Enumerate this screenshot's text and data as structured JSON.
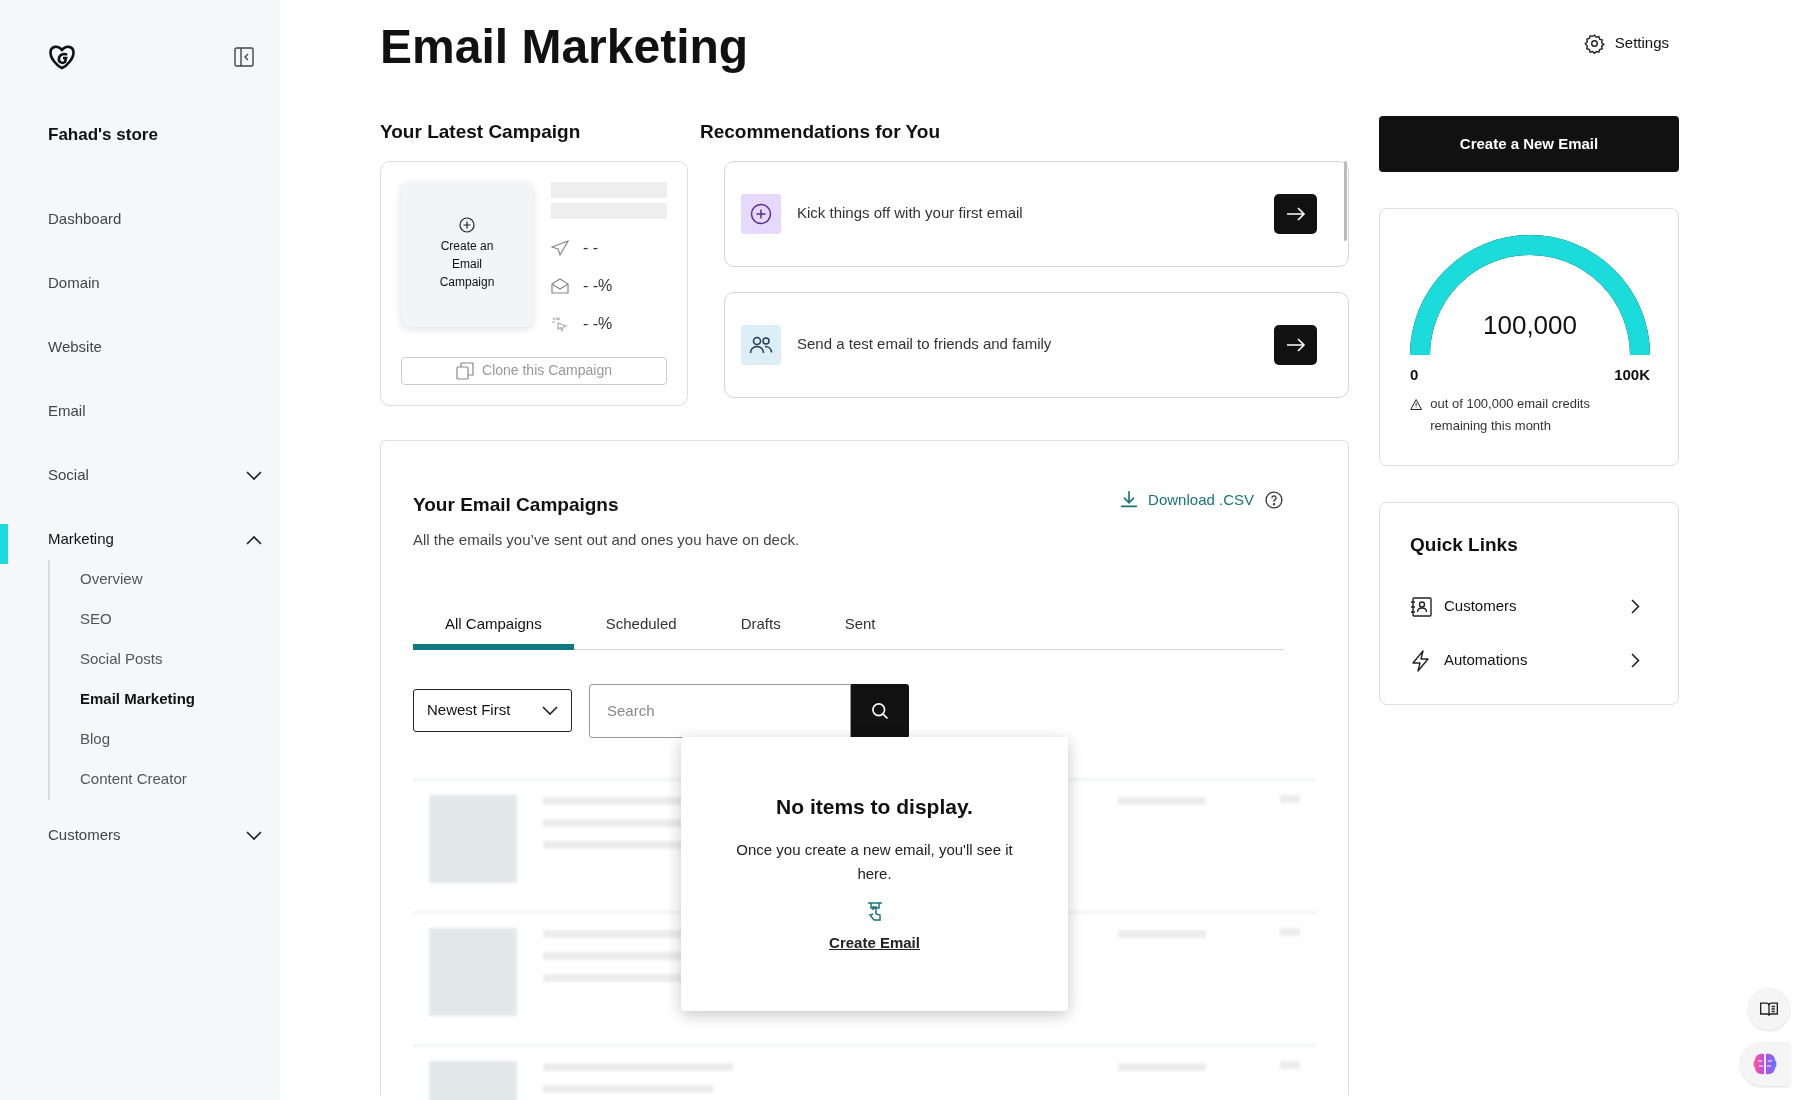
{
  "sidebar": {
    "store_name": "Fahad's store",
    "items": [
      {
        "label": "Dashboard",
        "kind": "link",
        "selected": false
      },
      {
        "label": "Domain",
        "kind": "link",
        "selected": false
      },
      {
        "label": "Website",
        "kind": "link",
        "selected": false
      },
      {
        "label": "Email",
        "kind": "link",
        "selected": false
      },
      {
        "label": "Social",
        "kind": "group",
        "selected": false,
        "expanded": false
      },
      {
        "label": "Marketing",
        "kind": "group",
        "selected": true,
        "expanded": true,
        "children": [
          {
            "label": "Overview",
            "selected": false
          },
          {
            "label": "SEO",
            "selected": false
          },
          {
            "label": "Social Posts",
            "selected": false
          },
          {
            "label": "Email Marketing",
            "selected": true
          },
          {
            "label": "Blog",
            "selected": false
          },
          {
            "label": "Content Creator",
            "selected": false
          }
        ]
      },
      {
        "label": "Customers",
        "kind": "group",
        "selected": false,
        "expanded": false
      }
    ]
  },
  "header": {
    "title": "Email Marketing",
    "settings": "Settings"
  },
  "latest_campaign": {
    "heading": "Your Latest Campaign",
    "create_label": "Create an Email Campaign",
    "stats": [
      {
        "kind": "sent",
        "value": "- -"
      },
      {
        "kind": "opened",
        "value": "- -%"
      },
      {
        "kind": "clicked",
        "value": "- -%"
      }
    ],
    "clone_button": "Clone this Campaign"
  },
  "recommendations": {
    "heading": "Recommendations for You",
    "items": [
      {
        "kind": "add",
        "text": "Kick things off with your first email"
      },
      {
        "kind": "people",
        "text": "Send a test email to friends and family"
      }
    ]
  },
  "create_button": "Create a New Email",
  "credits": {
    "value": "100,000",
    "level": 1,
    "min_label": "0",
    "max_label": "100K",
    "note": "out of 100,000 email credits remaining this month"
  },
  "quick_links": {
    "heading": "Quick Links",
    "items": [
      {
        "kind": "contacts",
        "label": "Customers"
      },
      {
        "kind": "bolt",
        "label": "Automations"
      }
    ]
  },
  "campaigns": {
    "heading": "Your Email Campaigns",
    "subtitle": "All the emails you’ve sent out and ones you have on deck.",
    "download": "Download .CSV",
    "tabs": [
      {
        "label": "All Campaigns",
        "selected": true
      },
      {
        "label": "Scheduled",
        "selected": false
      },
      {
        "label": "Drafts",
        "selected": false
      },
      {
        "label": "Sent",
        "selected": false
      }
    ],
    "sort": "Newest First",
    "search": {
      "placeholder": "Search"
    },
    "empty": {
      "title": "No items to display.",
      "message": "Once you create a new email, you'll see it here.",
      "link": "Create Email"
    }
  }
}
